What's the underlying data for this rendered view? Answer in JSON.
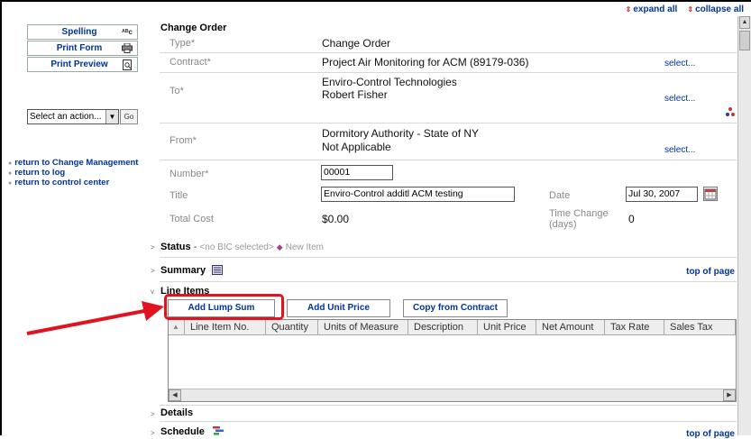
{
  "left_toolbar": {
    "spelling": "Spelling",
    "spelling_icon": "ᴬᴮc",
    "print_form": "Print Form",
    "print_preview": "Print Preview",
    "action_select": "Select an action...",
    "go": "Go",
    "links": [
      "return to Change Management",
      "return to log",
      "return to control center"
    ]
  },
  "header": {
    "expand_all": "expand all",
    "collapse_all": "collapse all",
    "title": "Change Order"
  },
  "form": {
    "type_label": "Type*",
    "type_value": "Change Order",
    "contract_label": "Contract*",
    "contract_value": "Project Air Monitoring for ACM (89179-036)",
    "to_label": "To*",
    "to_company": "Enviro-Control Technologies",
    "to_person": "Robert Fisher",
    "from_label": "From*",
    "from_company": "Dormitory Authority - State of NY",
    "from_person": "Not Applicable",
    "select_link": "select...",
    "number_label": "Number*",
    "number_value": "00001",
    "title_label": "Title",
    "title_value": "Enviro-Control additl ACM testing",
    "date_label": "Date",
    "date_value": "Jul 30, 2007",
    "total_cost_label": "Total Cost",
    "total_cost_value": "$0.00",
    "time_change_label": "Time Change (days)",
    "time_change_value": "0"
  },
  "sections": {
    "status_label": "Status",
    "status_bic": "<no BIC selected>",
    "status_new": "New Item",
    "summary": "Summary",
    "line_items": "Line Items",
    "details": "Details",
    "schedule": "Schedule",
    "top_of_page": "top of page"
  },
  "line_items": {
    "buttons": [
      "Add Lump Sum",
      "Add Unit Price",
      "Copy from Contract"
    ],
    "columns": [
      "Line Item No.",
      "Quantity",
      "Units of Measure",
      "Description",
      "Unit Price",
      "Net Amount",
      "Tax Rate",
      "Sales Tax"
    ]
  },
  "colors": {
    "link": "#00339a",
    "highlight": "#e0141e"
  }
}
